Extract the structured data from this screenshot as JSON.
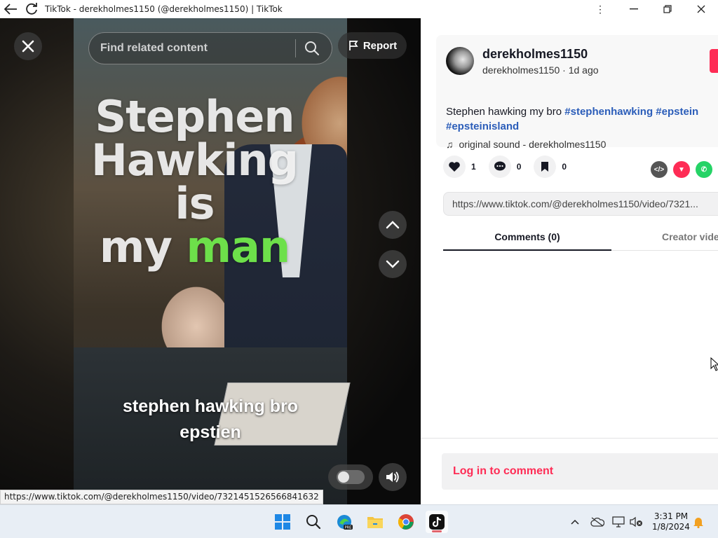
{
  "window": {
    "title": "TikTok - derekholmes1150 (@derekholmes1150) | TikTok"
  },
  "video": {
    "search_placeholder": "Find related content",
    "report_label": "Report",
    "overlay_line1": "Stephen",
    "overlay_line2": "Hawking is",
    "overlay_line3_a": "my ",
    "overlay_line3_b": "man",
    "caption_line1": "stephen hawking bro",
    "caption_line2": "epstien"
  },
  "status_url": "https://www.tiktok.com/@derekholmes1150/video/7321451526566841632",
  "post": {
    "username": "derekholmes1150",
    "subline": "derekholmes1150 · 1d ago",
    "description_text": "Stephen hawking my bro ",
    "tags": [
      "#stephenhawking",
      "#epstein",
      "#epsteinisland"
    ],
    "sound": "original sound - derekholmes1150",
    "likes": "1",
    "comments": "0",
    "saves": "0",
    "link": "https://www.tiktok.com/@derekholmes1150/video/7321..."
  },
  "tabs": {
    "comments": "Comments (0)",
    "creator": "Creator videos"
  },
  "login_prompt": "Log in to comment",
  "clock": {
    "time": "3:31 PM",
    "date": "1/8/2024"
  },
  "colors": {
    "brand_red": "#fe2c55",
    "hashtag_blue": "#2b5db9",
    "overlay_green": "#6de04a"
  }
}
